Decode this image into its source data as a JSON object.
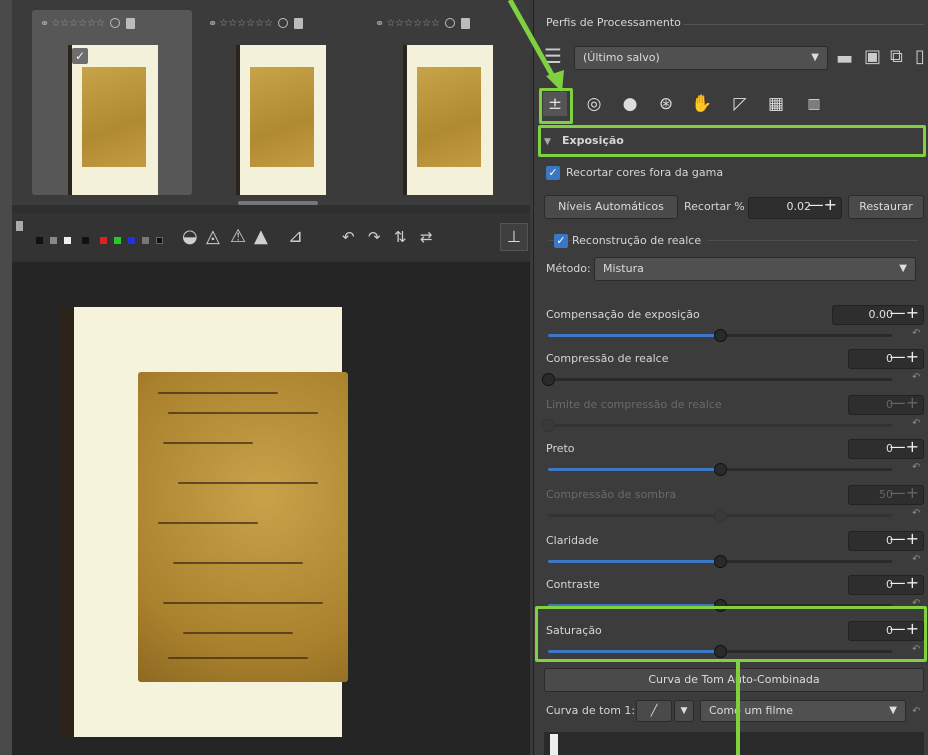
{
  "filmstrip": {
    "thumbs": [
      {
        "stars": "☆☆☆☆☆☆",
        "selected": true
      },
      {
        "stars": "☆☆☆☆☆☆",
        "selected": false
      },
      {
        "stars": "☆☆☆☆☆☆",
        "selected": false
      }
    ]
  },
  "profiles": {
    "header": "Perfis de Processamento",
    "current": "(Último salvo)"
  },
  "exposure": {
    "section_title": "Exposição",
    "clip_label": "Recortar cores fora da gama",
    "auto_levels_label": "Níveis Automáticos",
    "clip_percent_label": "Recortar %",
    "clip_percent_value": "0.02",
    "reset_label": "Restaurar",
    "highlight_recon_label": "Reconstrução de realce",
    "method_label": "Método:",
    "method_value": "Mistura",
    "sliders": [
      {
        "label": "Compensação de exposição",
        "value": "0.00",
        "position": 0.5,
        "dim": false
      },
      {
        "label": "Compressão de realce",
        "value": "0",
        "position": 0.0,
        "dim": false
      },
      {
        "label": "Limite de compressão de realce",
        "value": "0",
        "position": 0.0,
        "dim": true
      },
      {
        "label": "Preto",
        "value": "0",
        "position": 0.5,
        "dim": false
      },
      {
        "label": "Compressão de sombra",
        "value": "50",
        "position": 0.5,
        "dim": true
      },
      {
        "label": "Claridade",
        "value": "0",
        "position": 0.5,
        "dim": false
      },
      {
        "label": "Contraste",
        "value": "0",
        "position": 0.5,
        "dim": false
      },
      {
        "label": "Saturação",
        "value": "0",
        "position": 0.5,
        "dim": false
      }
    ],
    "tone_curve_button": "Curva de Tom Auto-Combinada",
    "tone_curve_1_label": "Curva de tom 1:",
    "tone_curve_1_mode": "Como um filme"
  },
  "colors": {
    "highlight": "#7fd140",
    "slider_fill": "#3c78c4"
  }
}
